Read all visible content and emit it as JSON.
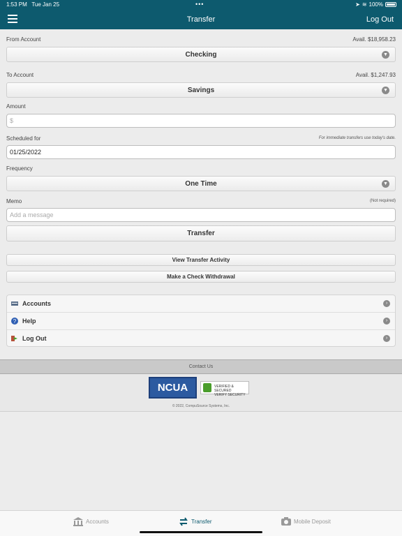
{
  "status_bar": {
    "time": "1:53 PM",
    "date": "Tue Jan 25",
    "battery": "100%"
  },
  "nav": {
    "title": "Transfer",
    "logout_label": "Log Out",
    "menu_icon": "hamburger-icon"
  },
  "form": {
    "from_label": "From Account",
    "from_available": "Avail. $18,958.23",
    "from_value": "Checking",
    "to_label": "To Account",
    "to_available": "Avail. $1,247.93",
    "to_value": "Savings",
    "amount_label": "Amount",
    "amount_placeholder": "$",
    "scheduled_label": "Scheduled for",
    "scheduled_hint": "For immediate transfers use today's date.",
    "scheduled_value": "01/25/2022",
    "frequency_label": "Frequency",
    "frequency_value": "One Time",
    "memo_label": "Memo",
    "memo_hint": "(Not required)",
    "memo_placeholder": "Add a message",
    "submit_label": "Transfer"
  },
  "actions": {
    "view_activity": "View Transfer Activity",
    "check_withdrawal": "Make a Check Withdrawal"
  },
  "links": [
    {
      "label": "Accounts",
      "icon": "accounts-icon"
    },
    {
      "label": "Help",
      "icon": "help-icon"
    },
    {
      "label": "Log Out",
      "icon": "logout-icon"
    }
  ],
  "footer": {
    "contact": "Contact Us",
    "ncua": "NCUA",
    "secure_line1": "VERIFIED & SECURED",
    "secure_line2": "VERIFY SECURITY",
    "copyright": "© 2022, CompuSource Systems, Inc."
  },
  "tabbar": {
    "tabs": [
      {
        "label": "Accounts",
        "icon": "bank-icon"
      },
      {
        "label": "Transfer",
        "icon": "transfer-arrows-icon",
        "active": true
      },
      {
        "label": "Mobile Deposit",
        "icon": "camera-icon"
      }
    ]
  },
  "colors": {
    "brand": "#0d5a6e",
    "background": "#ececec"
  }
}
